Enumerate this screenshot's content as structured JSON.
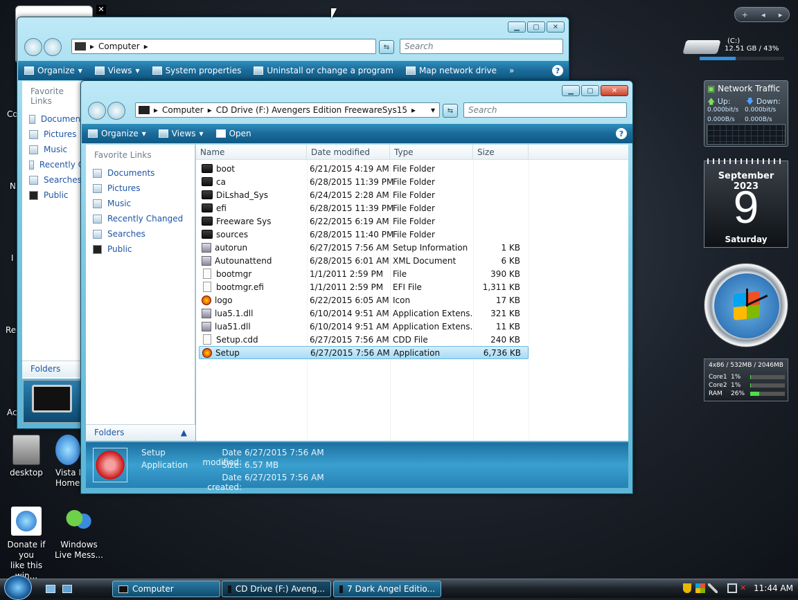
{
  "desktop": {
    "icons": [
      {
        "label_1": "desktop",
        "label_2": ""
      },
      {
        "label_1": "Vista I",
        "label_2": "Home"
      },
      {
        "label_1": "Donate if you",
        "label_2": "like this win..."
      },
      {
        "label_1": "Windows",
        "label_2": "Live Mess..."
      }
    ],
    "edge_labels": [
      "Co",
      "N",
      "I",
      "Rec",
      "Ac"
    ]
  },
  "back_window": {
    "address": [
      "Computer"
    ],
    "search_placeholder": "Search",
    "toolbar": [
      "Organize",
      "Views",
      "System properties",
      "Uninstall or change a program",
      "Map network drive"
    ],
    "favorites_header": "Favorite Links",
    "nav_items": [
      "Document",
      "Pictures",
      "Music",
      "Recently C",
      "Searches",
      "Public"
    ],
    "folders_label": "Folders"
  },
  "front_window": {
    "address": [
      "Computer",
      "CD Drive (F:) Avengers Edition FreewareSys15"
    ],
    "search_placeholder": "Search",
    "toolbar": [
      "Organize",
      "Views",
      "Open"
    ],
    "favorites_header": "Favorite Links",
    "nav_items": [
      "Documents",
      "Pictures",
      "Music",
      "Recently Changed",
      "Searches",
      "Public"
    ],
    "folders_label": "Folders",
    "columns": [
      "Name",
      "Date modified",
      "Type",
      "Size"
    ],
    "files": [
      {
        "name": "boot",
        "date": "6/21/2015 4:19 AM",
        "type": "File Folder",
        "size": "",
        "icon": "folder"
      },
      {
        "name": "ca",
        "date": "6/28/2015 11:39 PM",
        "type": "File Folder",
        "size": "",
        "icon": "folder"
      },
      {
        "name": "DiLshad_Sys",
        "date": "6/24/2015 2:28 AM",
        "type": "File Folder",
        "size": "",
        "icon": "folder"
      },
      {
        "name": "efi",
        "date": "6/28/2015 11:39 PM",
        "type": "File Folder",
        "size": "",
        "icon": "folder"
      },
      {
        "name": "Freeware Sys",
        "date": "6/22/2015 6:19 AM",
        "type": "File Folder",
        "size": "",
        "icon": "folder"
      },
      {
        "name": "sources",
        "date": "6/28/2015 11:40 PM",
        "type": "File Folder",
        "size": "",
        "icon": "folder"
      },
      {
        "name": "autorun",
        "date": "6/27/2015 7:56 AM",
        "type": "Setup Information",
        "size": "1 KB",
        "icon": "gear"
      },
      {
        "name": "Autounattend",
        "date": "6/28/2015 6:01 AM",
        "type": "XML Document",
        "size": "6 KB",
        "icon": "gear"
      },
      {
        "name": "bootmgr",
        "date": "1/1/2011 2:59 PM",
        "type": "File",
        "size": "390 KB",
        "icon": "file"
      },
      {
        "name": "bootmgr.efi",
        "date": "1/1/2011 2:59 PM",
        "type": "EFI File",
        "size": "1,311 KB",
        "icon": "file"
      },
      {
        "name": "logo",
        "date": "6/22/2015 6:05 AM",
        "type": "Icon",
        "size": "17 KB",
        "icon": "logo"
      },
      {
        "name": "lua5.1.dll",
        "date": "6/10/2014 9:51 AM",
        "type": "Application Extens...",
        "size": "321 KB",
        "icon": "gear"
      },
      {
        "name": "lua51.dll",
        "date": "6/10/2014 9:51 AM",
        "type": "Application Extens...",
        "size": "11 KB",
        "icon": "gear"
      },
      {
        "name": "Setup.cdd",
        "date": "6/27/2015 7:56 AM",
        "type": "CDD File",
        "size": "240 KB",
        "icon": "file"
      },
      {
        "name": "Setup",
        "date": "6/27/2015 7:56 AM",
        "type": "Application",
        "size": "6,736 KB",
        "icon": "logo",
        "selected": true
      }
    ],
    "details": {
      "name": "Setup",
      "kind": "Application",
      "modified_label": "Date modified:",
      "modified_value": "6/27/2015 7:56 AM",
      "size_label": "Size:",
      "size_value": "6.57 MB",
      "created_label": "Date created:",
      "created_value": "6/27/2015 7:56 AM"
    }
  },
  "gadgets": {
    "drive": {
      "label": "(C:)",
      "info": "12.51 GB / 43%",
      "used_fraction": 0.43
    },
    "network": {
      "title": "Network Traffic",
      "up": "Up:",
      "down": "Down:",
      "up_rate": "0.000bit/s",
      "down_rate": "0.000bit/s",
      "up_bytes": "0.000B/s",
      "down_bytes": "0.000B/s"
    },
    "calendar": {
      "month": "September 2023",
      "day": "9",
      "weekday": "Saturday"
    },
    "cpu": {
      "header": "4x86 / 532MB / 2046MB",
      "rows": [
        {
          "label": "Core1",
          "value": "1%",
          "fraction": 0.01
        },
        {
          "label": "Core2",
          "value": "1%",
          "fraction": 0.01
        },
        {
          "label": "RAM",
          "value": "26%",
          "fraction": 0.26
        }
      ]
    }
  },
  "taskbar": {
    "buttons": [
      "Computer",
      "CD Drive (F:) Aveng...",
      "7 Dark Angel Editio..."
    ],
    "clock": "11:44 AM"
  }
}
